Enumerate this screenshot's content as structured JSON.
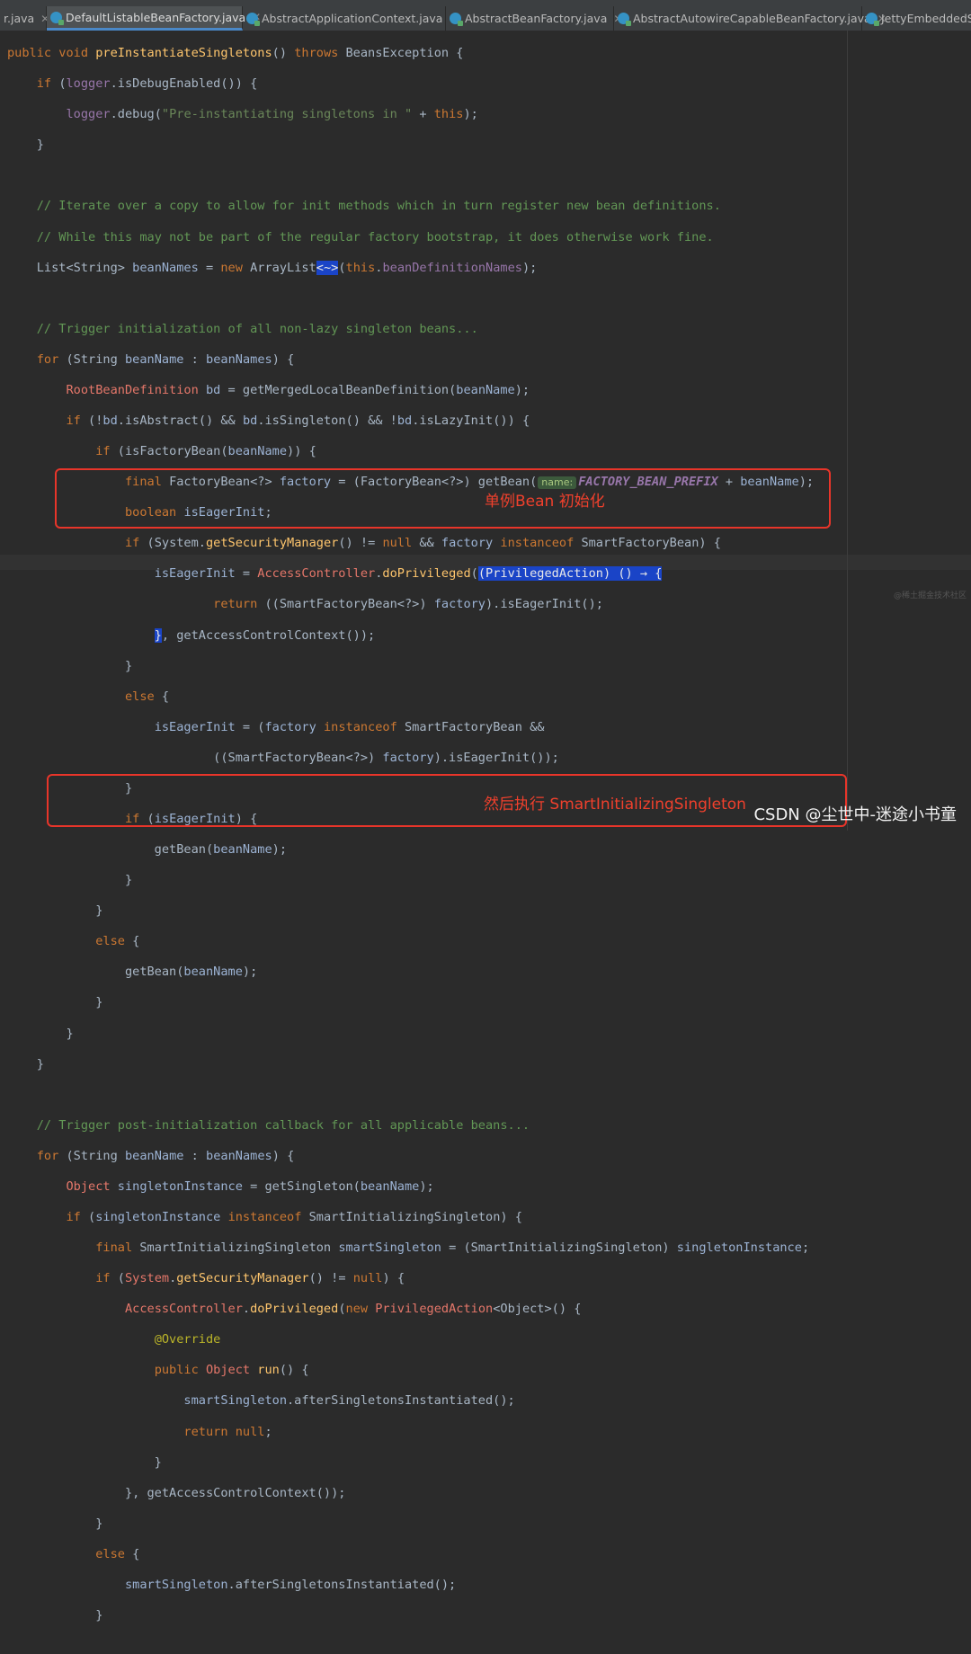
{
  "tabs": [
    {
      "label": "r.java",
      "active": false
    },
    {
      "label": "DefaultListableBeanFactory.java",
      "active": true
    },
    {
      "label": "AbstractApplicationContext.java",
      "active": false
    },
    {
      "label": "AbstractBeanFactory.java",
      "active": false
    },
    {
      "label": "AbstractAutowireCapableBeanFactory.java",
      "active": false
    },
    {
      "label": "JettyEmbeddedSe",
      "active": false
    }
  ],
  "inlay_hint": "name:",
  "annotations": {
    "box1_label": "单例Bean 初始化",
    "box2_label": "然后执行 SmartInitializingSingleton"
  },
  "watermark": {
    "main": "CSDN @尘世中-迷途小书童",
    "small": "@稀土掘金技术社区"
  },
  "colors": {
    "background": "#2b2b2b",
    "keyword": "#cc7832",
    "comment": "#629755",
    "string": "#6a8759",
    "field": "#9876aa",
    "method": "#ffc66d",
    "annotation_red": "#e8352a"
  }
}
